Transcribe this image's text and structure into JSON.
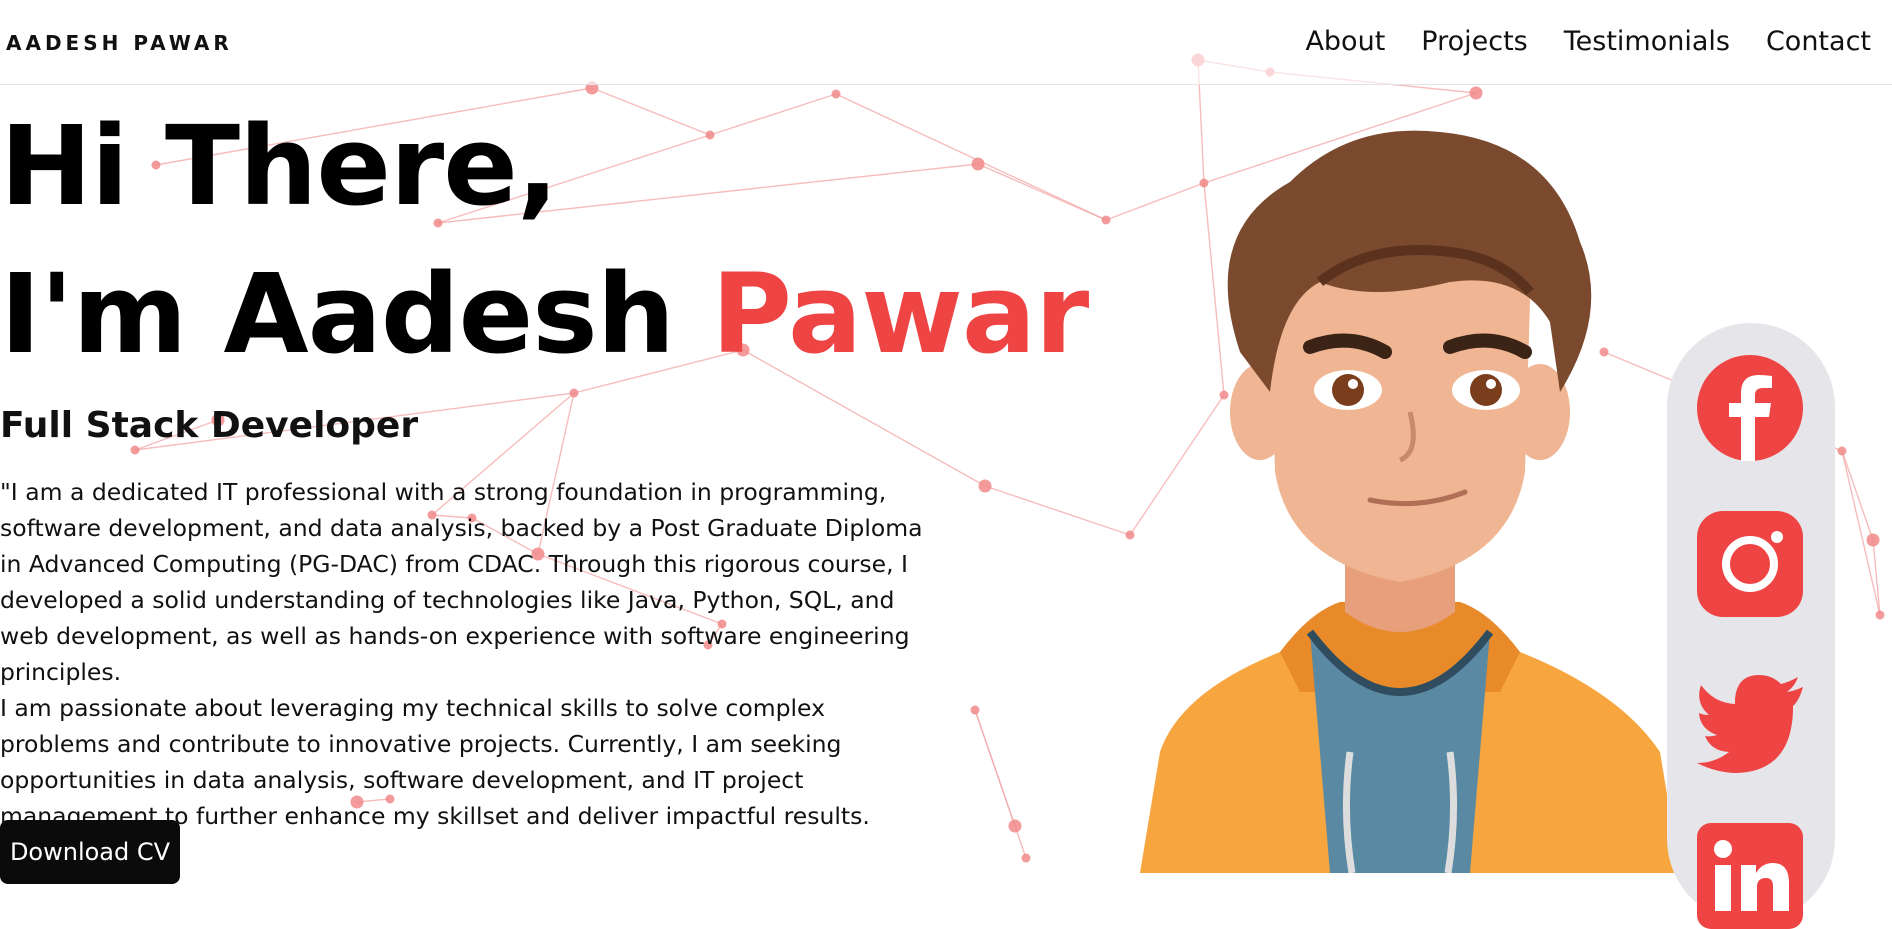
{
  "nav": {
    "logo": "AADESH PAWAR",
    "links": [
      "About",
      "Projects",
      "Testimonials",
      "Contact"
    ]
  },
  "hero": {
    "greeting": "Hi There,",
    "intro_prefix": "I'm Aadesh ",
    "intro_accent": "Pawar",
    "role": "Full Stack Developer",
    "bio_paragraph_1": "\"I am a dedicated IT professional with a strong foundation in programming, software development, and data analysis, backed by a Post Graduate Diploma in Advanced Computing (PG-DAC) from CDAC. Through this rigorous course, I developed a solid understanding of technologies like Java, Python, SQL, and web development, as well as hands-on experience with software engineering principles.",
    "bio_paragraph_2": "I am passionate about leveraging my technical skills to solve complex problems and contribute to innovative projects. Currently, I am seeking opportunities in data analysis, software development, and IT project management to further enhance my skillset and deliver impactful results.",
    "cta_label": "Download CV"
  },
  "social": {
    "icons": [
      "facebook-icon",
      "instagram-icon",
      "twitter-icon",
      "linkedin-icon"
    ]
  },
  "colors": {
    "accent": "#ef4444",
    "button_bg": "#0b0b0b",
    "social_bar_bg": "#e6e6ea",
    "hoodie": "#f7a53f",
    "hair": "#7b4a2e",
    "skin": "#f0b693",
    "shirt": "#5a8aa3"
  }
}
